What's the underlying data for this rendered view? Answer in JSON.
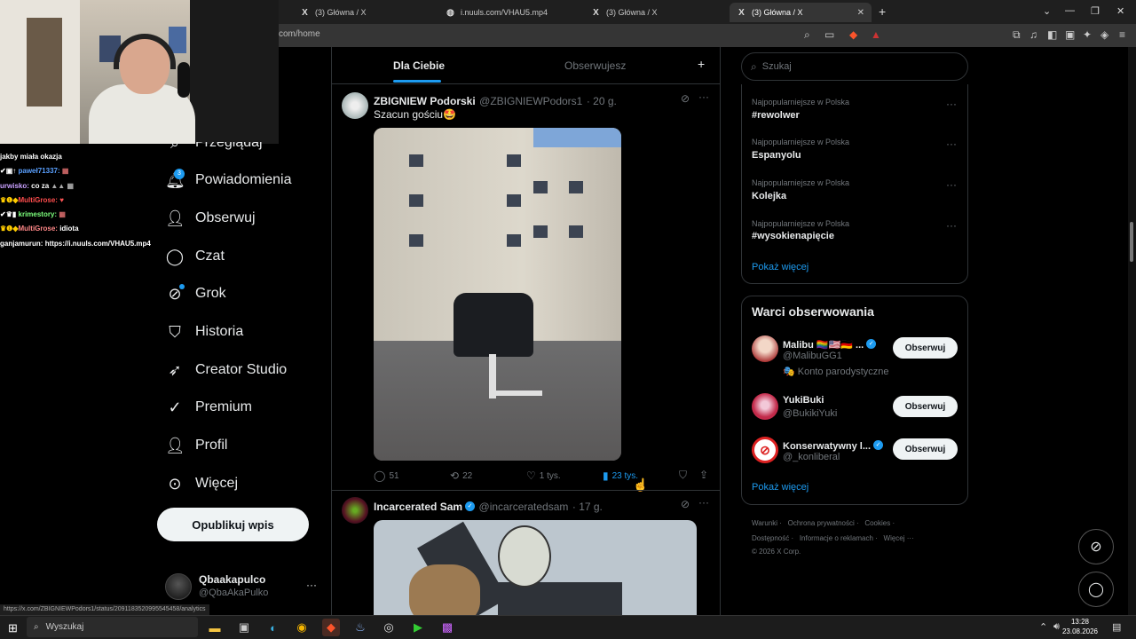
{
  "browser": {
    "tabs": [
      {
        "label": "(3) Główna / X",
        "favicon": "x-logo-icon"
      },
      {
        "label": "i.nuuls.com/VHAU5.mp4",
        "favicon": "globe-icon"
      },
      {
        "label": "(3) Główna / X",
        "favicon": "x-logo-icon"
      },
      {
        "label": "(3) Główna / X",
        "favicon": "x-logo-icon",
        "active": true
      }
    ],
    "url": "com/home",
    "status_url": "https://x.com/ZBIGNIEWPodors1/status/2091183520995545458/analytics"
  },
  "chat": {
    "lines": [
      {
        "user": "",
        "text": "jakby miała okazja"
      },
      {
        "user": "paweł71337:",
        "text": ""
      },
      {
        "user": "urwisko:",
        "text": "co za"
      },
      {
        "user": "MultiGrose:",
        "text": ""
      },
      {
        "user": "krimestory:",
        "text": ""
      },
      {
        "user": "MultiGrose:",
        "text": "idiota"
      },
      {
        "user": "ganjamurun:",
        "text": "https://i.nuuls.com/VHAU5.mp4"
      }
    ]
  },
  "nav": {
    "items": [
      {
        "label": "Przeglądaj",
        "icon": "search-icon"
      },
      {
        "label": "Powiadomienia",
        "icon": "bell-icon",
        "badge": "3"
      },
      {
        "label": "Obserwuj",
        "icon": "person-plus-icon"
      },
      {
        "label": "Czat",
        "icon": "chat-bubble-icon"
      },
      {
        "label": "Grok",
        "icon": "grok-icon"
      },
      {
        "label": "Historia",
        "icon": "bookmark-icon"
      },
      {
        "label": "Creator Studio",
        "icon": "rocket-icon"
      },
      {
        "label": "Premium",
        "icon": "verified-icon"
      },
      {
        "label": "Profil",
        "icon": "person-icon"
      },
      {
        "label": "Więcej",
        "icon": "more-circle-icon"
      }
    ],
    "post_button": "Opublikuj wpis",
    "account": {
      "name": "Qbaakapulco",
      "handle": "@QbaAkaPulko",
      "more": "···"
    }
  },
  "timeline": {
    "tabs": {
      "for_you": "Dla Ciebie",
      "following": "Obserwujesz",
      "plus": "+"
    },
    "tweets": [
      {
        "name": "ZBIGNIEW Podorski",
        "handle": "@ZBIGNIEWPodors1",
        "time": "· 20 g.",
        "text": "Szacun gościu🤩",
        "replies": "51",
        "reposts": "22",
        "likes": "1 tys.",
        "views": "23 tys."
      },
      {
        "name": "Incarcerated Sam",
        "handle": "@incarceratedsam",
        "time": "· 17 g.",
        "verified": true
      }
    ]
  },
  "sidebar": {
    "search_placeholder": "Szukaj",
    "trends": [
      {
        "context": "Najpopularniejsze w Polska",
        "name": "#rewolwer"
      },
      {
        "context": "Najpopularniejsze w Polska",
        "name": "Espanyolu"
      },
      {
        "context": "Najpopularniejsze w Polska",
        "name": "Kolejka"
      },
      {
        "context": "Najpopularniejsze w Polska",
        "name": "#wysokienapięcie"
      }
    ],
    "show_more": "Pokaż więcej",
    "who_to_follow": {
      "title": "Warci obserwowania",
      "accounts": [
        {
          "name": "Malibu 🏳️‍🌈🇺🇸🇩🇪 ...",
          "handle": "@MalibuGG1",
          "note": "🎭 Konto parodystyczne",
          "verified": true,
          "button": "Obserwuj"
        },
        {
          "name": "YukiBuki",
          "handle": "@BukikiYuki",
          "verified": false,
          "button": "Obserwuj"
        },
        {
          "name": "Konserwatywny l...",
          "handle": "@_konliberal",
          "verified": true,
          "button": "Obserwuj"
        }
      ],
      "show_more": "Pokaż więcej"
    },
    "footer": [
      "Warunki",
      "Ochrona prywatności",
      "Cookies",
      "Dostępność",
      "Informacje o reklamach",
      "Więcej ···",
      "© 2026 X Corp."
    ]
  },
  "taskbar": {
    "search": "Wyszukaj",
    "time": "13:28",
    "date": "23.08.2026"
  }
}
